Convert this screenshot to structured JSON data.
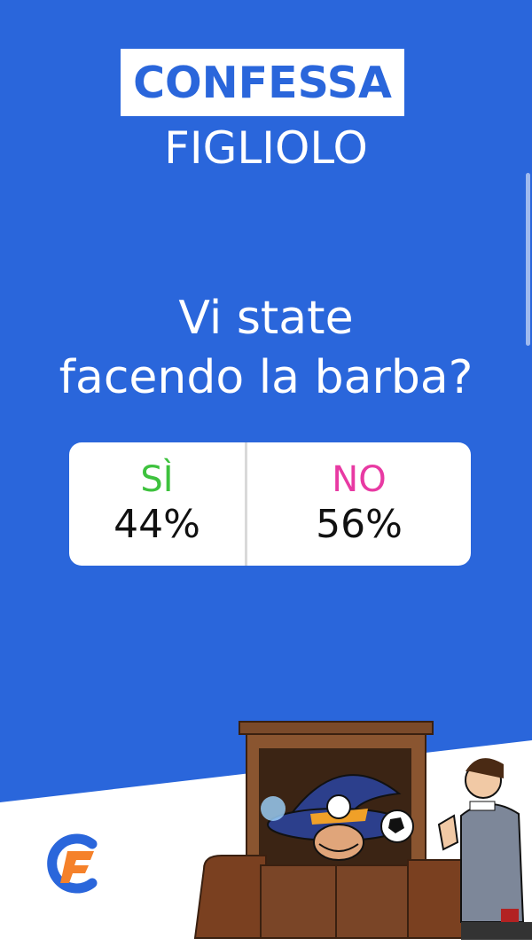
{
  "colors": {
    "background": "#2a66db",
    "title_text": "#2a66db",
    "yes": "#3ec23e",
    "no": "#e83aa3",
    "percent_text": "#111111"
  },
  "header": {
    "title": "CONFESSA",
    "subtitle": "FIGLIOLO"
  },
  "question": {
    "line1": "Vi state",
    "line2": "facendo la barba?"
  },
  "poll": {
    "options": [
      {
        "label": "SÌ",
        "percent": "44%",
        "value": 44
      },
      {
        "label": "NO",
        "percent": "56%",
        "value": 56
      }
    ]
  },
  "decor": {
    "logo_icon": "brand-logo-icon",
    "illustration": "confessional-cartoon-illustration"
  }
}
